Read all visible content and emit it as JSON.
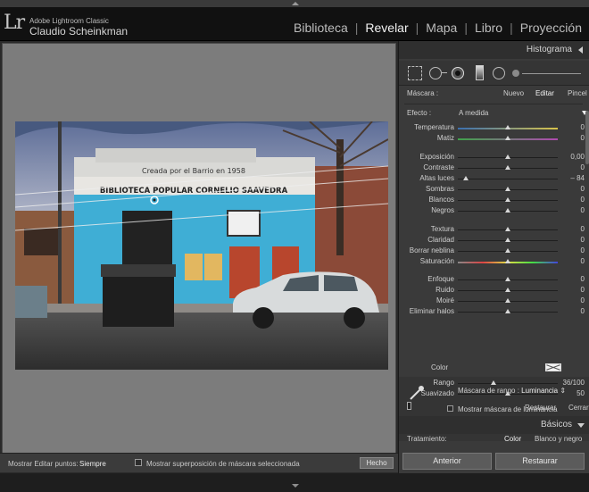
{
  "app": {
    "logo": "Lr",
    "product": "Adobe Lightroom Classic",
    "user": "Claudio Scheinkman"
  },
  "modules": [
    "Biblioteca",
    "Revelar",
    "Mapa",
    "Libro",
    "Proyección"
  ],
  "active_module": "Revelar",
  "panel": {
    "histogram_title": "Histograma",
    "mask_label": "Máscara :",
    "mask_new": "Nuevo",
    "mask_edit": "Editar",
    "mask_brush": "Pincel",
    "effect_label": "Efecto :",
    "effect_value": "A medida",
    "sliders": [
      {
        "name": "temperatura",
        "label": "Temperatura",
        "value": "0",
        "pos": 0.5,
        "group": "color"
      },
      {
        "name": "matiz",
        "label": "Matiz",
        "value": "0",
        "pos": 0.5,
        "group": "tint"
      },
      {
        "name": "exposicion",
        "label": "Exposición",
        "value": "0,00",
        "pos": 0.5,
        "group": "tone"
      },
      {
        "name": "contraste",
        "label": "Contraste",
        "value": "0",
        "pos": 0.5,
        "group": "tone"
      },
      {
        "name": "altas-luces",
        "label": "Altas luces",
        "value": "– 84",
        "pos": 0.08,
        "group": "tone"
      },
      {
        "name": "sombras",
        "label": "Sombras",
        "value": "0",
        "pos": 0.5,
        "group": "tone"
      },
      {
        "name": "blancos",
        "label": "Blancos",
        "value": "0",
        "pos": 0.5,
        "group": "tone"
      },
      {
        "name": "negros",
        "label": "Negros",
        "value": "0",
        "pos": 0.5,
        "group": "tone"
      },
      {
        "name": "textura",
        "label": "Textura",
        "value": "0",
        "pos": 0.5,
        "group": "presence"
      },
      {
        "name": "claridad",
        "label": "Claridad",
        "value": "0",
        "pos": 0.5,
        "group": "presence"
      },
      {
        "name": "borrar-neblina",
        "label": "Borrar neblina",
        "value": "0",
        "pos": 0.5,
        "group": "presence"
      },
      {
        "name": "saturacion",
        "label": "Saturación",
        "value": "0",
        "pos": 0.5,
        "group": "saturation"
      },
      {
        "name": "enfoque",
        "label": "Enfoque",
        "value": "0",
        "pos": 0.5,
        "group": "detail"
      },
      {
        "name": "ruido",
        "label": "Ruido",
        "value": "0",
        "pos": 0.5,
        "group": "detail"
      },
      {
        "name": "moire",
        "label": "Moiré",
        "value": "0",
        "pos": 0.5,
        "group": "detail"
      },
      {
        "name": "eliminar-halos",
        "label": "Eliminar halos",
        "value": "0",
        "pos": 0.5,
        "group": "detail"
      }
    ],
    "color_label": "Color",
    "range_mask_label": "Máscara de rango :",
    "range_mask_value": "Luminancia",
    "show_mask_label": "Mostrar máscara de luminancia",
    "range_sliders": [
      {
        "name": "rango",
        "label": "Rango",
        "value": "36/100",
        "pos": 0.36
      },
      {
        "name": "suavizado",
        "label": "Suavizado",
        "value": "50",
        "pos": 0.5
      }
    ],
    "restore_label": "Restaurar",
    "close_label": "Cerrar",
    "basic_title": "Básicos",
    "treatment_label": "Tratamiento:",
    "treatment_color": "Color",
    "treatment_bw": "Blanco y negro",
    "prev_button": "Anterior",
    "reset_button": "Restaurar"
  },
  "toolbar": {
    "show_edit_label": "Mostrar Editar puntos:",
    "show_edit_value": "Siempre",
    "overlay_label": "Mostrar superposición de máscara seleccionada",
    "done_button": "Hecho"
  },
  "photo": {
    "sign_top": "Creada por el Barrio en 1958",
    "sign_main": "BIBLIOTECA POPULAR CORNELIO SAAVEDRA"
  }
}
